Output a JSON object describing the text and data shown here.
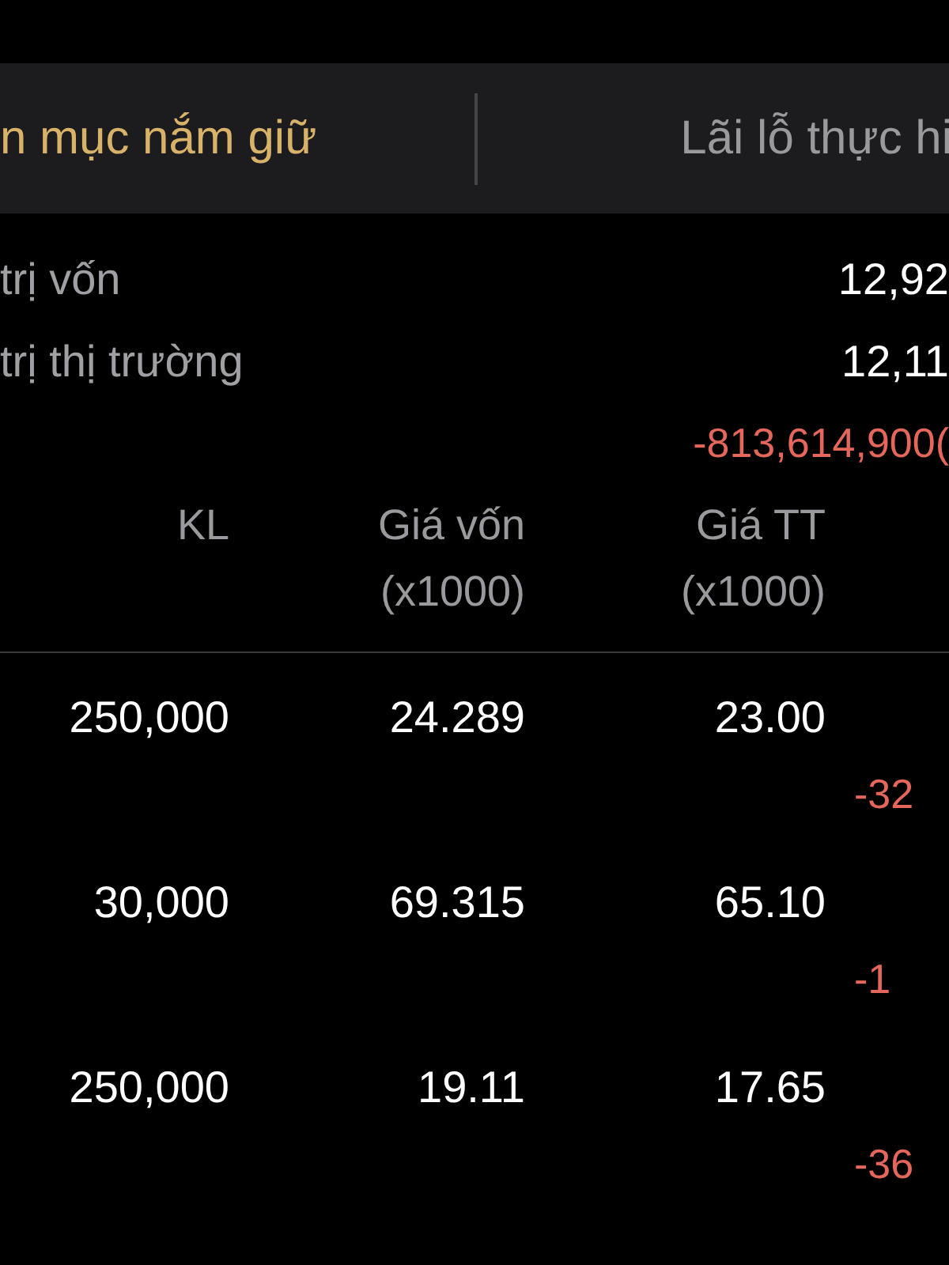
{
  "tabs": [
    {
      "label": "n mục nắm giữ",
      "selected": true
    },
    {
      "label": "Lãi lỗ thực hi",
      "selected": false
    }
  ],
  "summary": [
    {
      "label": "trị vốn",
      "value": "12,92"
    },
    {
      "label": "trị thị trường",
      "value": "12,11"
    }
  ],
  "total_change": "-813,614,900(",
  "columns": [
    "KL",
    "Giá vốn\n(x1000)",
    "Giá TT\n(x1000)"
  ],
  "rows": [
    {
      "kl": "250,000",
      "cost_price": "24.289",
      "market_price": "23.00",
      "profit_loss": "-32"
    },
    {
      "kl": "30,000",
      "cost_price": "69.315",
      "market_price": "65.10",
      "profit_loss": "-1"
    },
    {
      "kl": "250,000",
      "cost_price": "19.11",
      "market_price": "17.65",
      "profit_loss": "-36"
    }
  ]
}
